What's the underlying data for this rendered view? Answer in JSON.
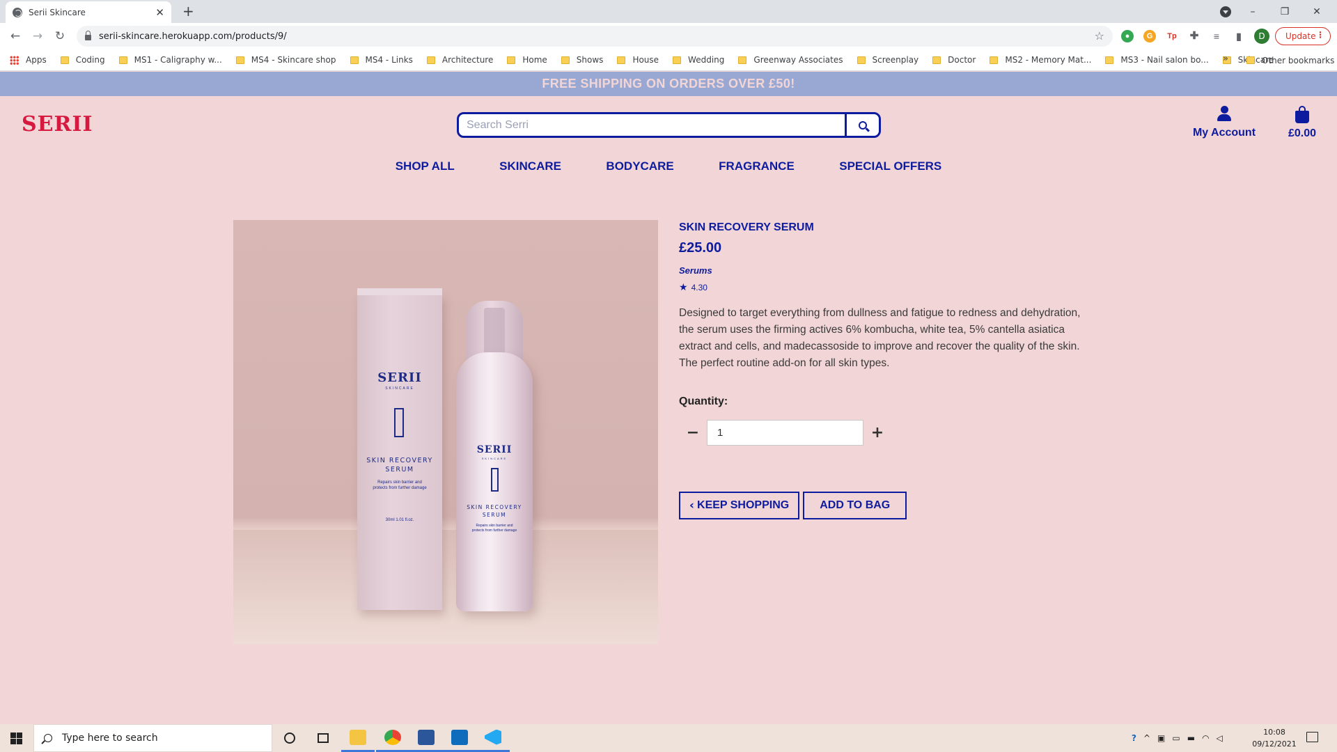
{
  "browser": {
    "tab_title": "Serii Skincare",
    "url": "serii-skincare.herokuapp.com/products/9/",
    "update_label": "Update",
    "profile_initial": "D",
    "bookmarks": [
      "Apps",
      "Coding",
      "MS1 - Caligraphy w...",
      "MS4 - Skincare shop",
      "MS4 - Links",
      "Architecture",
      "Home",
      "Shows",
      "House",
      "Wedding",
      "Greenway Associates",
      "Screenplay",
      "Doctor",
      "MS2 - Memory Mat...",
      "MS3 - Nail salon bo...",
      "Skincare"
    ],
    "other_bookmarks": "Other bookmarks"
  },
  "site": {
    "promo": "FREE SHIPPING ON ORDERS OVER £50!",
    "logo": "SERII",
    "search_placeholder": "Search Serri",
    "account_label": "My Account",
    "bag_total": "£0.00",
    "nav": [
      "SHOP ALL",
      "SKINCARE",
      "BODYCARE",
      "FRAGRANCE",
      "SPECIAL OFFERS"
    ]
  },
  "product": {
    "name": "SKIN RECOVERY SERUM",
    "price": "£25.00",
    "category": "Serums",
    "rating": "4.30",
    "description": "Designed to target everything from dullness and fatigue to redness and dehydration, the serum uses the firming actives 6% kombucha, white tea, 5% cantella asiatica extract and cells, and madecassoside to improve and recover the quality of the skin. The perfect routine add-on for all skin types.",
    "quantity_label": "Quantity:",
    "quantity_value": "1",
    "keep_shopping": "KEEP SHOPPING",
    "add_to_bag": "ADD TO BAG",
    "image": {
      "brand": "SERII",
      "brand_sub": "SKINCARE",
      "label_line1": "SKIN RECOVERY",
      "label_line2": "SERUM",
      "small_line1": "Repairs skin barrier and",
      "small_line2": "protects from further damage",
      "volume": "30ml 1.01 fl.oz."
    }
  },
  "taskbar": {
    "search_placeholder": "Type here to search",
    "time": "10:08",
    "date": "09/12/2021"
  },
  "colors": {
    "page_bg": "#f2d5d7",
    "promo_bg": "#98a8d2",
    "brand_blue": "#0d1c9e",
    "logo_red": "#d6193e"
  }
}
